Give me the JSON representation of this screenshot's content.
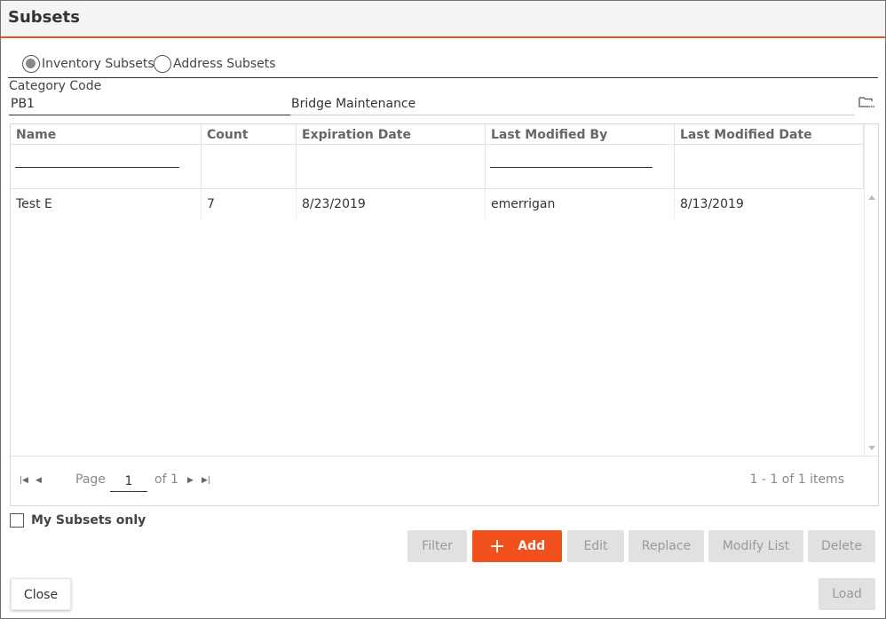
{
  "dialog": {
    "title": "Subsets"
  },
  "subset_type": {
    "options": [
      {
        "label": "Inventory Subsets",
        "selected": true
      },
      {
        "label": "Address Subsets",
        "selected": false
      }
    ]
  },
  "category": {
    "label": "Category Code",
    "code": "PB1",
    "description": "Bridge Maintenance"
  },
  "grid": {
    "columns": [
      "Name",
      "Count",
      "Expiration Date",
      "Last Modified By",
      "Last Modified Date"
    ],
    "rows": [
      {
        "name": "Test E",
        "count": "7",
        "expiration": "8/23/2019",
        "modified_by": "emerrigan",
        "modified_date": "8/13/2019"
      }
    ],
    "pager": {
      "page_label": "Page",
      "page": "1",
      "of_label": "of 1",
      "info": "1 - 1 of 1 items"
    }
  },
  "my_subsets_only": {
    "label": "My Subsets only",
    "checked": false
  },
  "buttons": {
    "filter": "Filter",
    "add": "Add",
    "edit": "Edit",
    "replace": "Replace",
    "modify_list": "Modify List",
    "delete": "Delete",
    "close": "Close",
    "load": "Load"
  },
  "colors": {
    "accent": "#f2501d",
    "title_underline": "#e4572e",
    "disabled_button": "#e1e1e1"
  },
  "icons": {
    "category_lookup": "folder-lookup-icon",
    "add": "plus-icon"
  }
}
